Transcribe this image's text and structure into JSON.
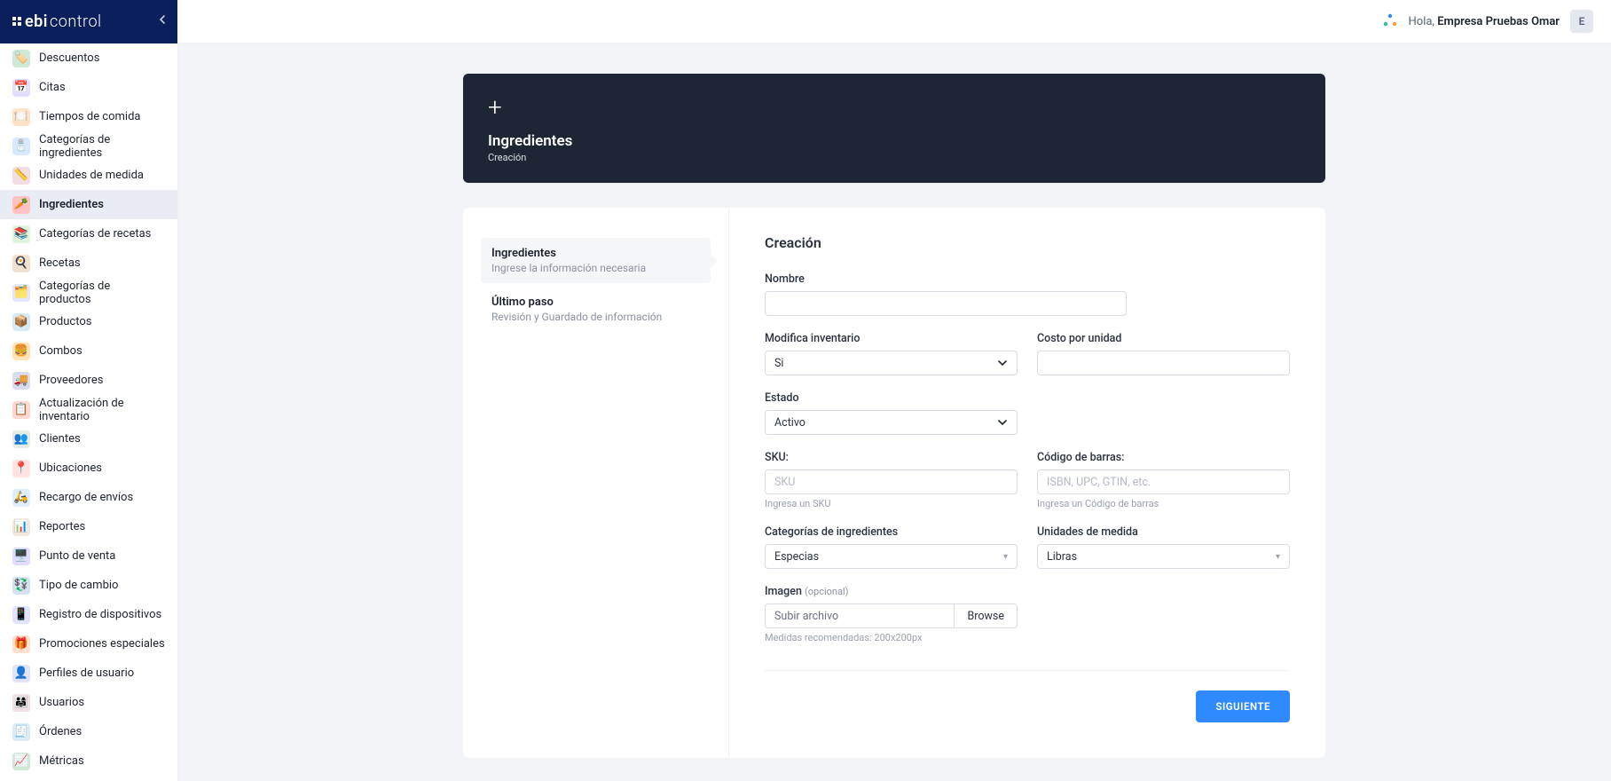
{
  "brand": {
    "name_a": "ebi",
    "name_b": "control"
  },
  "header": {
    "greeting_prefix": "Hola, ",
    "greeting_name": "Empresa Pruebas Omar",
    "avatar_initial": "E"
  },
  "sidebar": {
    "items": [
      {
        "label": "Descuentos",
        "icon": "🏷️",
        "cls": "ic1"
      },
      {
        "label": "Citas",
        "icon": "📅",
        "cls": "ic2"
      },
      {
        "label": "Tiempos de comida",
        "icon": "🍽️",
        "cls": "ic3"
      },
      {
        "label": "Categorías de ingredientes",
        "icon": "🧂",
        "cls": "ic4"
      },
      {
        "label": "Unidades de medida",
        "icon": "📏",
        "cls": "ic5"
      },
      {
        "label": "Ingredientes",
        "icon": "🥕",
        "cls": "ic6",
        "active": true
      },
      {
        "label": "Categorías de recetas",
        "icon": "📚",
        "cls": "ic7"
      },
      {
        "label": "Recetas",
        "icon": "🍳",
        "cls": "ic8"
      },
      {
        "label": "Categorías de productos",
        "icon": "🗂️",
        "cls": "ic9"
      },
      {
        "label": "Productos",
        "icon": "📦",
        "cls": "ic10"
      },
      {
        "label": "Combos",
        "icon": "🍔",
        "cls": "ic11"
      },
      {
        "label": "Proveedores",
        "icon": "🚚",
        "cls": "ic12"
      },
      {
        "label": "Actualización de inventario",
        "icon": "📋",
        "cls": "ic13"
      },
      {
        "label": "Clientes",
        "icon": "👥",
        "cls": "ic14"
      },
      {
        "label": "Ubicaciones",
        "icon": "📍",
        "cls": "ic15"
      },
      {
        "label": "Recargo de envíos",
        "icon": "🛵",
        "cls": "ic16"
      },
      {
        "label": "Reportes",
        "icon": "📊",
        "cls": "ic17"
      },
      {
        "label": "Punto de venta",
        "icon": "🖥️",
        "cls": "ic18"
      },
      {
        "label": "Tipo de cambio",
        "icon": "💱",
        "cls": "ic19"
      },
      {
        "label": "Registro de dispositivos",
        "icon": "📱",
        "cls": "ic20"
      },
      {
        "label": "Promociones especiales",
        "icon": "🎁",
        "cls": "ic21"
      },
      {
        "label": "Perfiles de usuario",
        "icon": "👤",
        "cls": "ic22"
      },
      {
        "label": "Usuarios",
        "icon": "👨‍👩‍👧",
        "cls": "ic23"
      },
      {
        "label": "Órdenes",
        "icon": "🧾",
        "cls": "ic24"
      },
      {
        "label": "Métricas",
        "icon": "📈",
        "cls": "ic1"
      }
    ]
  },
  "hero": {
    "title": "Ingredientes",
    "subtitle": "Creación"
  },
  "steps": [
    {
      "title": "Ingredientes",
      "sub": "Ingrese la información necesaria",
      "active": true
    },
    {
      "title": "Último paso",
      "sub": "Revisión y Guardado de información",
      "active": false
    }
  ],
  "form": {
    "title": "Creación",
    "nombre_label": "Nombre",
    "modifica_label": "Modifica inventario",
    "modifica_value": "Si",
    "costo_label": "Costo por unidad",
    "estado_label": "Estado",
    "estado_value": "Activo",
    "sku_label": "SKU:",
    "sku_placeholder": "SKU",
    "sku_hint": "Ingresa un SKU",
    "barcode_label": "Código de barras:",
    "barcode_placeholder": "ISBN, UPC, GTIN, etc.",
    "barcode_hint": "Ingresa un Código de barras",
    "cat_label": "Categorías de ingredientes",
    "cat_value": "Especias",
    "unit_label": "Unidades de medida",
    "unit_value": "Libras",
    "image_label": "Imagen ",
    "image_opt": "(opcional)",
    "file_placeholder": "Subir archivo",
    "file_button": "Browse",
    "file_hint": "Medidas recomendadas: 200x200px",
    "submit": "SIGUIENTE"
  }
}
